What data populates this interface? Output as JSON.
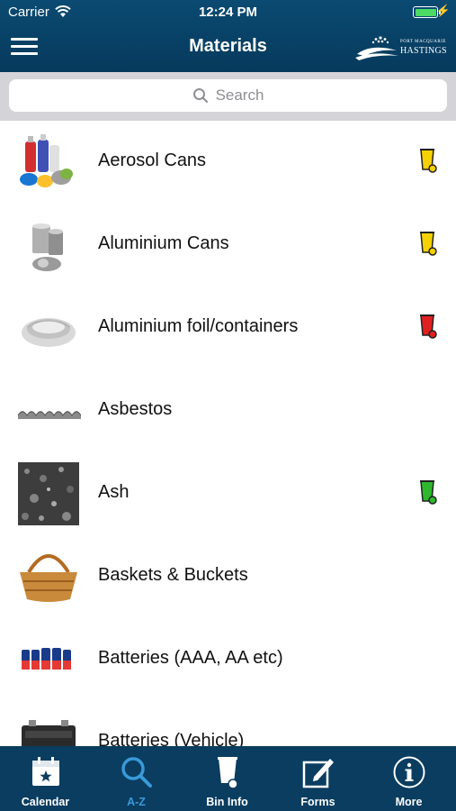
{
  "status": {
    "carrier": "Carrier",
    "time": "12:24 PM"
  },
  "header": {
    "title": "Materials",
    "logo_line1": "PORT MACQUARIE",
    "logo_line2": "HASTINGS"
  },
  "search": {
    "placeholder": "Search"
  },
  "colors": {
    "header": "#063a5c",
    "tabbar": "#0a3d60",
    "active_tab": "#3a9ad9",
    "bin_yellow": "#f5d100",
    "bin_red": "#e02020",
    "bin_green": "#2db82d"
  },
  "materials": [
    {
      "label": "Aerosol Cans",
      "image": "aerosol-cans-image",
      "bin": "yellow"
    },
    {
      "label": "Aluminium Cans",
      "image": "aluminium-cans-image",
      "bin": "yellow"
    },
    {
      "label": "Aluminium foil/containers",
      "image": "aluminium-foil-image",
      "bin": "red"
    },
    {
      "label": "Asbestos",
      "image": "asbestos-image",
      "bin": ""
    },
    {
      "label": "Ash",
      "image": "ash-image",
      "bin": "green"
    },
    {
      "label": "Baskets & Buckets",
      "image": "basket-image",
      "bin": ""
    },
    {
      "label": "Batteries (AAA, AA etc)",
      "image": "batteries-image",
      "bin": ""
    },
    {
      "label": "Batteries (Vehicle)",
      "image": "car-battery-image",
      "bin": ""
    }
  ],
  "tabs": [
    {
      "label": "Calendar",
      "icon": "calendar-icon",
      "active": false
    },
    {
      "label": "A-Z",
      "icon": "search-icon",
      "active": true
    },
    {
      "label": "Bin Info",
      "icon": "bin-icon",
      "active": false
    },
    {
      "label": "Forms",
      "icon": "edit-icon",
      "active": false
    },
    {
      "label": "More",
      "icon": "info-icon",
      "active": false
    }
  ]
}
